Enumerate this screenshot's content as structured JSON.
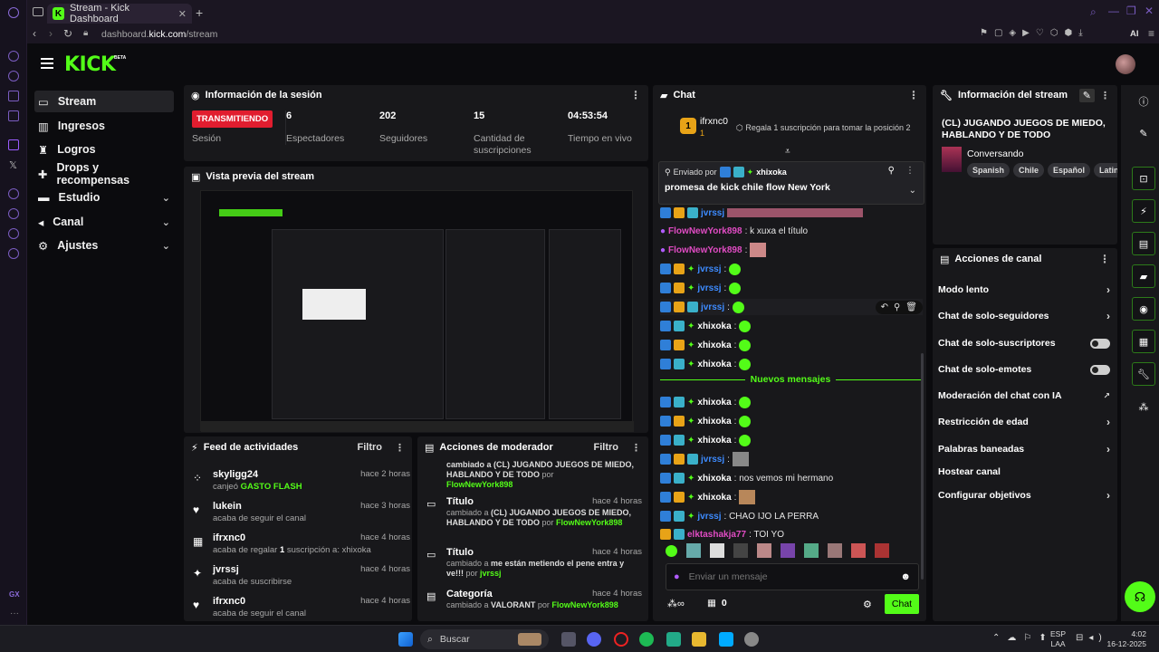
{
  "browser": {
    "tab_title": "Stream - Kick Dashboard",
    "favicon_letter": "K",
    "url_prefix": "dashboard.",
    "url_domain": "kick.com",
    "url_path": "/stream",
    "ai_label": "AI",
    "rail_label": "GX"
  },
  "brand": {
    "logo": "KICK",
    "beta": "BETA",
    "accent": "#53fc18"
  },
  "sidebar": {
    "items": [
      {
        "label": "Stream",
        "icon": "stream-icon"
      },
      {
        "label": "Ingresos",
        "icon": "revenue-icon"
      },
      {
        "label": "Logros",
        "icon": "trophy-icon"
      },
      {
        "label": "Drops y recompensas",
        "icon": "gift-icon"
      },
      {
        "label": "Estudio",
        "icon": "studio-icon"
      },
      {
        "label": "Canal",
        "icon": "channel-icon"
      },
      {
        "label": "Ajustes",
        "icon": "gear-icon"
      }
    ]
  },
  "session": {
    "title": "Información de la sesión",
    "status_badge": "TRANSMITIENDO",
    "status_label": "Sesión",
    "stats": [
      {
        "value": "6",
        "label": "Espectadores"
      },
      {
        "value": "202",
        "label": "Seguidores"
      },
      {
        "value": "15",
        "label": "Cantidad de suscripciones"
      },
      {
        "value": "04:53:54",
        "label": "Tiempo en vivo"
      }
    ]
  },
  "preview": {
    "title": "Vista previa del stream"
  },
  "feed": {
    "title": "Feed de actividades",
    "filter": "Filtro",
    "items": [
      {
        "name": "skyligg24",
        "pre": "canjeó ",
        "highlight": "GASTO FLASH",
        "post": "",
        "time": "hace 2 horas",
        "icon": "reward-icon"
      },
      {
        "name": "lukein",
        "pre": "acaba de seguir el canal",
        "highlight": "",
        "post": "",
        "time": "hace 3 horas",
        "icon": "heart-icon"
      },
      {
        "name": "ifrxnc0",
        "pre": "acaba de regalar ",
        "highlight": "1",
        "post": " suscripción a: xhixoka",
        "time": "hace 4 horas",
        "icon": "gift-icon"
      },
      {
        "name": "jvrssj",
        "pre": "acaba de suscribirse",
        "highlight": "",
        "post": "",
        "time": "hace 4 horas",
        "icon": "star-icon"
      },
      {
        "name": "ifrxnc0",
        "pre": "acaba de seguir el canal",
        "highlight": "",
        "post": "",
        "time": "hace 4 horas",
        "icon": "heart-icon"
      }
    ]
  },
  "modactions": {
    "title": "Acciones de moderador",
    "filter": "Filtro",
    "top_fragment": "cambiado a (CL) JUGANDO JUEGOS DE MIEDO, HABLANDO Y DE TODO",
    "top_by": "por",
    "top_user": "FlowNewYork898",
    "items": [
      {
        "title": "Título",
        "time": "hace 4 horas",
        "pre": "cambiado a ",
        "value": "(CL) JUGANDO JUEGOS DE MIEDO, HABLANDO Y DE TODO",
        "by": " por ",
        "user": "FlowNewYork898"
      },
      {
        "title": "Título",
        "time": "hace 4 horas",
        "pre": "cambiado a ",
        "value": "me están metiendo el pene",
        "post": " entra y ve!!!",
        "by": " por ",
        "user": "jvrssj"
      },
      {
        "title": "Categoría",
        "time": "hace 4 horas",
        "pre": "cambiado a ",
        "value": "VALORANT",
        "by": " por ",
        "user": "FlowNewYork898"
      }
    ]
  },
  "chat": {
    "title": "Chat",
    "top_user": "ifrxnc0",
    "top_rank": "1",
    "top_count": "1",
    "gift_prompt": "Regala 1 suscripción para tomar la posición 2",
    "pinned_by": "Enviado por",
    "pinned_user": "xhixoka",
    "pinned_text": "promesa de kick chile flow New York",
    "new_messages": "Nuevos mensajes",
    "messages": [
      {
        "user": "jvrssj",
        "color": "#3d8bff",
        "text": ""
      },
      {
        "user": "FlowNewYork898",
        "color": "#e14cc4",
        "text": ": k xuxa el título"
      },
      {
        "user": "FlowNewYork898",
        "color": "#e14cc4",
        "text": ":"
      },
      {
        "user": "jvrssj",
        "color": "#3d8bff",
        "text": ":"
      },
      {
        "user": "jvrssj",
        "color": "#3d8bff",
        "text": ":"
      },
      {
        "user": "jvrssj",
        "color": "#3d8bff",
        "text": ":"
      },
      {
        "user": "xhixoka",
        "color": "#ffffff",
        "text": ":"
      },
      {
        "user": "xhixoka",
        "color": "#ffffff",
        "text": ":"
      },
      {
        "user": "xhixoka",
        "color": "#ffffff",
        "text": ":"
      },
      {
        "user": "xhixoka",
        "color": "#ffffff",
        "text": ":"
      },
      {
        "user": "xhixoka",
        "color": "#ffffff",
        "text": ":"
      },
      {
        "user": "xhixoka",
        "color": "#ffffff",
        "text": ":"
      },
      {
        "user": "jvrssj",
        "color": "#3d8bff",
        "text": ":"
      },
      {
        "user": "xhixoka",
        "color": "#ffffff",
        "text": ": nos vemos mi hermano"
      },
      {
        "user": "xhixoka",
        "color": "#ffffff",
        "text": ":"
      },
      {
        "user": "jvrssj",
        "color": "#3d8bff",
        "text": ": CHAO IJO LA PERRA"
      },
      {
        "user": "elktashakja77",
        "color": "#e14cc4",
        "text": ": TOI YO"
      }
    ],
    "input_placeholder": "Enviar un mensaje",
    "points": "0",
    "send_label": "Chat"
  },
  "stream_info": {
    "title": "Información del stream",
    "stream_title": "(CL) JUGANDO JUEGOS DE MIEDO, HABLANDO Y DE TODO",
    "category": "Conversando",
    "tags": [
      "Spanish",
      "Chile",
      "Español",
      "Latino"
    ]
  },
  "channel_actions": {
    "title": "Acciones de canal",
    "items": [
      {
        "label": "Modo lento",
        "control": "chevron"
      },
      {
        "label": "Chat de solo-seguidores",
        "control": "chevron"
      },
      {
        "label": "Chat de solo-suscriptores",
        "control": "toggle"
      },
      {
        "label": "Chat de solo-emotes",
        "control": "toggle"
      },
      {
        "label": "Moderación del chat con IA",
        "control": "external"
      },
      {
        "label": "Restricción de edad",
        "control": "chevron"
      },
      {
        "label": "Palabras baneadas",
        "control": "chevron"
      },
      {
        "label": "Hostear canal",
        "control": "none"
      },
      {
        "label": "Configurar objetivos",
        "control": "chevron"
      }
    ]
  },
  "taskbar": {
    "search_placeholder": "Buscar",
    "lang": "ESP",
    "region": "LAA",
    "time": "4:02",
    "date": "16-12-2025"
  }
}
